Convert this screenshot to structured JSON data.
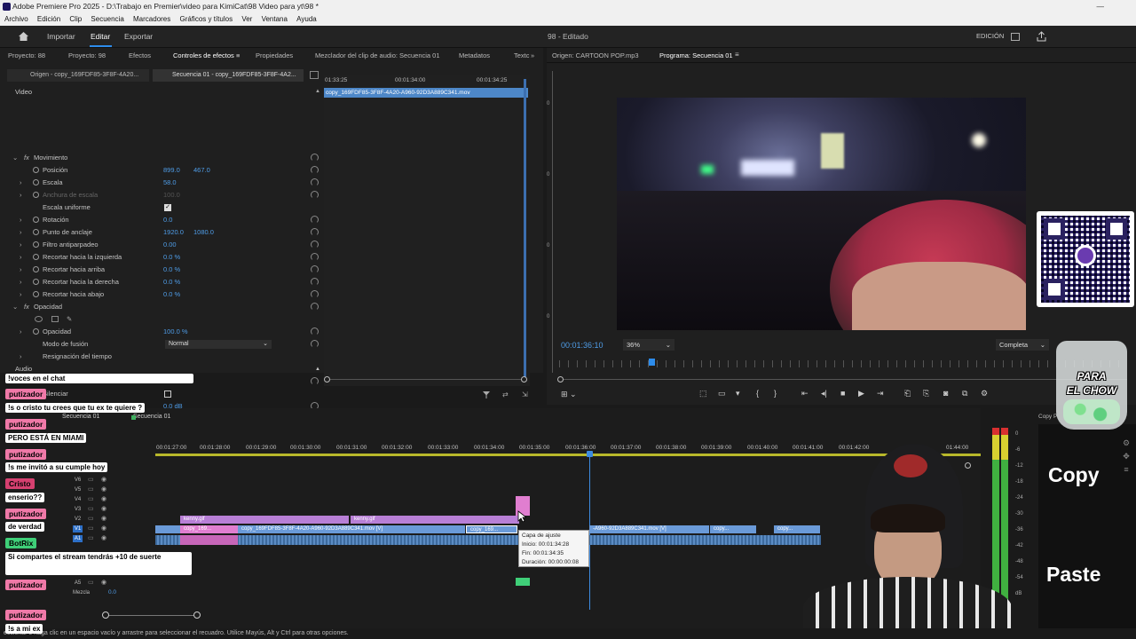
{
  "window": {
    "title": "Adobe Premiere Pro 2025 - D:\\Trabajo en Premier\\video para KimiCat\\98 Video para yt\\98 *"
  },
  "menu": [
    "Archivo",
    "Edición",
    "Clip",
    "Secuencia",
    "Marcadores",
    "Gráficos y títulos",
    "Ver",
    "Ventana",
    "Ayuda"
  ],
  "topbar": {
    "import": "Importar",
    "edit": "Editar",
    "export": "Exportar",
    "doc_title": "98 - Editado",
    "workspace": "EDICIÓN"
  },
  "left_tabs": [
    "Proyecto: 88",
    "Proyecto: 98",
    "Efectos",
    "Controles de efectos",
    "Propiedades",
    "Mezclador del clip de audio: Secuencia 01",
    "Metadatos",
    "Textc"
  ],
  "effect_controls": {
    "source_tab": "Origen - copy_169FDF85-3F8F-4A20...",
    "seq_tab": "Secuencia 01 - copy_169FDF85-3F8F-4A2...",
    "section_video": "Video",
    "section_audio": "Audio",
    "rows": [
      {
        "name": "Movimiento",
        "v1": "",
        "v2": ""
      },
      {
        "name": "Posición",
        "v1": "899.0",
        "v2": "467.0"
      },
      {
        "name": "Escala",
        "v1": "58.0",
        "v2": ""
      },
      {
        "name": "Anchura de escala",
        "v1": "100.0",
        "v2": ""
      },
      {
        "name": "Escala uniforme",
        "v1": "",
        "v2": ""
      },
      {
        "name": "Rotación",
        "v1": "0.0",
        "v2": ""
      },
      {
        "name": "Punto de anclaje",
        "v1": "1920.0",
        "v2": "1080.0"
      },
      {
        "name": "Filtro antiparpadeo",
        "v1": "0.00",
        "v2": ""
      },
      {
        "name": "Recortar hacia la izquierda",
        "v1": "0.0 %",
        "v2": ""
      },
      {
        "name": "Recortar hacia arriba",
        "v1": "0.0 %",
        "v2": ""
      },
      {
        "name": "Recortar hacia la derecha",
        "v1": "0.0 %",
        "v2": ""
      },
      {
        "name": "Recortar hacia abajo",
        "v1": "0.0 %",
        "v2": ""
      },
      {
        "name": "Opacidad",
        "v1": "",
        "v2": ""
      },
      {
        "name": "",
        "v1": "",
        "v2": ""
      },
      {
        "name": "Opacidad",
        "v1": "100.0 %",
        "v2": ""
      },
      {
        "name": "Modo de fusión",
        "v1": "Normal",
        "v2": ""
      },
      {
        "name": "Resignación del tiempo",
        "v1": "",
        "v2": ""
      },
      {
        "name": "Audio",
        "v1": "",
        "v2": ""
      },
      {
        "name": "Volumen",
        "v1": "",
        "v2": ""
      },
      {
        "name": "Silenciar",
        "v1": "",
        "v2": ""
      },
      {
        "name": "Nivel",
        "v1": "0.0 dB",
        "v2": ""
      },
      {
        "name": "Volumen del canal",
        "v1": "",
        "v2": ""
      }
    ],
    "mini_timeline": {
      "t1": "01:33:25",
      "t2": "00:01:34:00",
      "t3": "00:01:34:25",
      "clip": "copy_169FDF85-3F8F-4A20-A960-92D3A889C341.mov"
    }
  },
  "monitor": {
    "source_tab": "Origen: CARTOON POP.mp3",
    "program_tab": "Programa: Secuencia 01",
    "timecode": "00:01:36:10",
    "zoom": "36%",
    "quality": "Completa"
  },
  "overlay": {
    "para": "PARA",
    "chow": "EL CHOW",
    "copy": "Copy",
    "paste": "Paste",
    "copyp": "Copy P"
  },
  "chat": [
    {
      "name": "",
      "msg": "!voces  en el chat"
    },
    {
      "name": "putizador",
      "msg": "!s o cristo tu crees que tu ex te quiere ?"
    },
    {
      "name": "putizador",
      "msg": "PERO ESTÁ EN MIAMI"
    },
    {
      "name": "putizador",
      "msg": "!s me invitó a su cumple hoy"
    },
    {
      "name": "Cristo",
      "msg": "enserio??"
    },
    {
      "name": "putizador",
      "msg": "de verdad"
    },
    {
      "name": "BotRix",
      "msg": "Si compartes el stream tendrás +10 de suerte"
    },
    {
      "name": "putizador",
      "msg": ""
    },
    {
      "name": "putizador",
      "msg": "!s a mi ex"
    }
  ],
  "timeline": {
    "seq_tab": "Secuencia 01",
    "seq_tab2": "Secuencia 01",
    "ticks": [
      "00:01:27:00",
      "00:01:28:00",
      "00:01:29:00",
      "00:01:30:00",
      "00:01:31:00",
      "00:01:32:00",
      "00:01:33:00",
      "00:01:34:00",
      "00:01:35:00",
      "00:01:36:00",
      "00:01:37:00",
      "00:01:38:00",
      "00:01:39:00",
      "00:01:40:00",
      "00:01:41:00",
      "00:01:42:00",
      "01:44:00"
    ],
    "tracks": [
      "V6",
      "V5",
      "V4",
      "V3",
      "V2",
      "V1",
      "A1",
      "A5",
      "Mezcla"
    ],
    "mix_val": "0.0",
    "clips": {
      "kenny1": "kenny.gif",
      "kenny2": "kenny.gif",
      "copy1": "copy_169...",
      "copy2": "copy_169FDF85-3F8F-4A20-A960-92D3A889C341.mov [V]",
      "copy3": "copy_169...",
      "copy4": "-A960-92D3A889C341.mov [V]",
      "copy5": "copy...",
      "copy6": "copy..."
    },
    "tooltip": {
      "l1": "Capa de ajuste",
      "l2": "Inicio: 00:01:34:28",
      "l3": "Fin: 00:01:34:35",
      "l4": "Duración: 00:00:00:08"
    },
    "meter_labels": [
      "0",
      "-6",
      "-12",
      "-18",
      "-24",
      "-30",
      "-36",
      "-42",
      "-48",
      "-54",
      "dB"
    ]
  },
  "status": "eccionar o haga clic en un espacio vacío y arrastre para seleccionar el recuadro. Utilice Mayús, Alt y Ctrl para otras opciones."
}
